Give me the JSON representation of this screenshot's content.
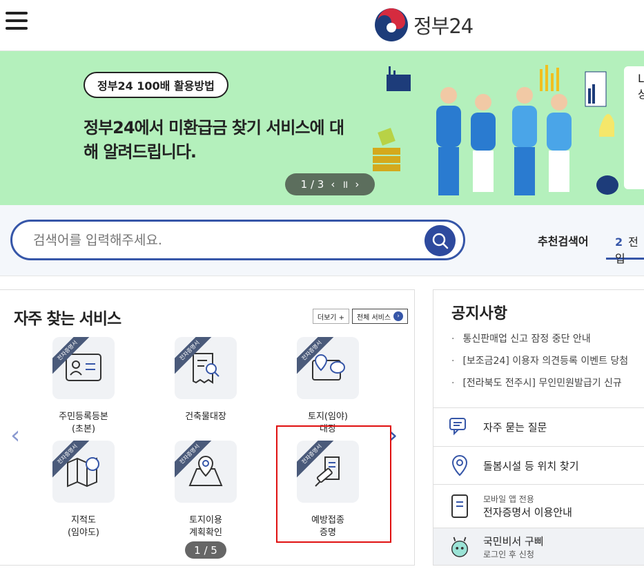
{
  "header": {
    "menu_icon": "hamburger-icon",
    "logo_text": "정부24"
  },
  "banner": {
    "tag": "정부24 100배 활용방법",
    "text": "정부24에서 미환급금 찾기 서비스에 대해 알려드립니다.",
    "pager": "1 / 3",
    "prev": "‹",
    "pause": "॥",
    "next": "›",
    "side_text": "L\n상"
  },
  "search": {
    "placeholder": "검색어를 입력해주세요.",
    "rec_label": "추천검색어",
    "rec_num": "2",
    "rec_text": "전입"
  },
  "services": {
    "title": "자주 찾는 서비스",
    "more_label": "더보기 +",
    "all_label": "전체 서비스",
    "ribbon": "전자증명서",
    "items": [
      {
        "label": "주민등록등본\n(초본)",
        "icon": "id-card-icon"
      },
      {
        "label": "건축물대장",
        "icon": "document-search-icon"
      },
      {
        "label": "토지(임야)\n대장",
        "icon": "land-map-icon"
      },
      {
        "label": "지적도\n(임야도)",
        "icon": "cadastral-map-icon"
      },
      {
        "label": "토지이용\n계획확인",
        "icon": "land-use-icon"
      },
      {
        "label": "예방접종\n증명",
        "icon": "vaccine-icon"
      }
    ],
    "pager": "1 / 5"
  },
  "notice": {
    "title": "공지사항",
    "items": [
      "통신판매업 신고 잠정 중단 안내",
      "[보조금24] 이용자 의견등록 이벤트 당첨",
      "[전라북도 전주시] 무인민원발급기 신규"
    ]
  },
  "quick_links": [
    {
      "label": "자주 묻는 질문",
      "icon": "faq-icon"
    },
    {
      "label": "돌봄시설 등 위치 찾기",
      "icon": "location-pin-icon"
    },
    {
      "small": "모바일 앱 전용",
      "label": "전자증명서 이용안내",
      "icon": "mobile-cert-icon"
    },
    {
      "label": "국민비서 구삐",
      "small": "로그인 후 신청",
      "icon": "secretary-gupi-icon"
    }
  ],
  "colors": {
    "primary": "#3656a8",
    "banner_bg": "#b4f0bc",
    "highlight": "#e01010"
  }
}
